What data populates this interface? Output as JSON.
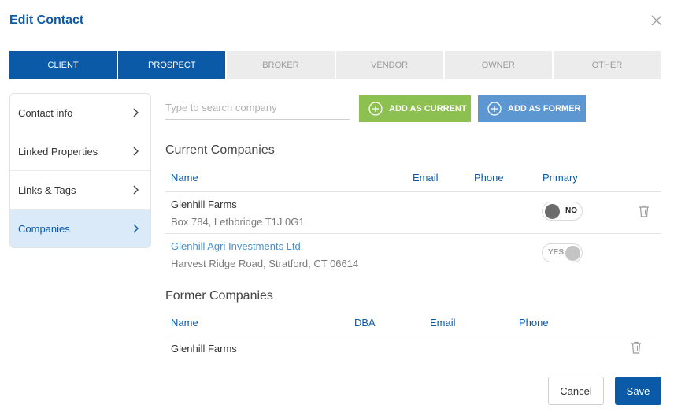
{
  "dialog": {
    "title": "Edit Contact"
  },
  "tabs": [
    {
      "label": "CLIENT",
      "active": true
    },
    {
      "label": "PROSPECT",
      "active": true
    },
    {
      "label": "BROKER",
      "active": false
    },
    {
      "label": "VENDOR",
      "active": false
    },
    {
      "label": "OWNER",
      "active": false
    },
    {
      "label": "OTHER",
      "active": false
    }
  ],
  "sidebar": {
    "items": [
      {
        "label": "Contact info",
        "active": false
      },
      {
        "label": "Linked Properties",
        "active": false
      },
      {
        "label": "Links & Tags",
        "active": false
      },
      {
        "label": "Companies",
        "active": true
      }
    ]
  },
  "search": {
    "placeholder": "Type to search company",
    "value": ""
  },
  "actions": {
    "add_current": "ADD AS CURRENT",
    "add_former": "ADD AS FORMER"
  },
  "current": {
    "heading": "Current Companies",
    "columns": {
      "name": "Name",
      "email": "Email",
      "phone": "Phone",
      "primary": "Primary"
    },
    "rows": [
      {
        "name": "Glenhill Farms",
        "address": "Box 784, Lethbridge T1J 0G1",
        "primary": "NO"
      },
      {
        "name": "Glenhill Agri Investments Ltd.",
        "address": "Harvest Ridge Road, Stratford, CT 06614",
        "primary": "YES"
      }
    ]
  },
  "former": {
    "heading": "Former Companies",
    "columns": {
      "name": "Name",
      "dba": "DBA",
      "email": "Email",
      "phone": "Phone"
    },
    "rows": [
      {
        "name": "Glenhill Farms"
      }
    ]
  },
  "footer": {
    "cancel": "Cancel",
    "save": "Save"
  },
  "colors": {
    "brand": "#0a5aa8",
    "add_current": "#8cc152",
    "add_former": "#5c97d1",
    "sidebar_active": "#dbeaf8"
  }
}
